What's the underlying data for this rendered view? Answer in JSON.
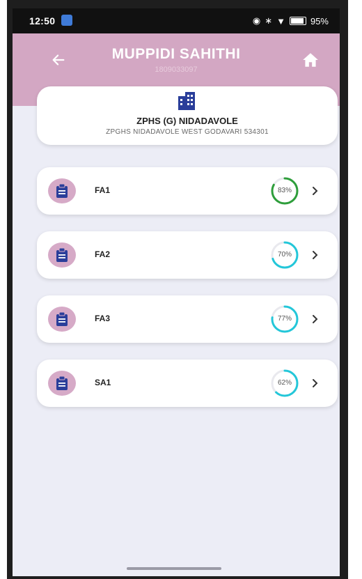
{
  "status_bar": {
    "time": "12:50",
    "battery": "95%",
    "icons": [
      "eye-icon",
      "bluetooth-icon",
      "wifi-icon",
      "battery-icon"
    ]
  },
  "header": {
    "title": "MUPPIDI SAHITHI",
    "subtitle": "1809033097",
    "back_icon": "arrow-left-icon",
    "home_icon": "home-icon",
    "color": "#d3a7c3"
  },
  "school": {
    "icon": "building-icon",
    "name": "ZPHS (G) NIDADAVOLE",
    "address": "ZPGHS NIDADAVOLE WEST GODAVARI 534301"
  },
  "assessments": [
    {
      "label": "FA1",
      "percent": 83,
      "percent_text": "83%",
      "color": "#2e9e3b",
      "icon": "clipboard-icon"
    },
    {
      "label": "FA2",
      "percent": 70,
      "percent_text": "70%",
      "color": "#23c7d9",
      "icon": "clipboard-icon"
    },
    {
      "label": "FA3",
      "percent": 77,
      "percent_text": "77%",
      "color": "#23c7d9",
      "icon": "clipboard-icon"
    },
    {
      "label": "SA1",
      "percent": 62,
      "percent_text": "62%",
      "color": "#23c7d9",
      "icon": "clipboard-icon"
    }
  ]
}
